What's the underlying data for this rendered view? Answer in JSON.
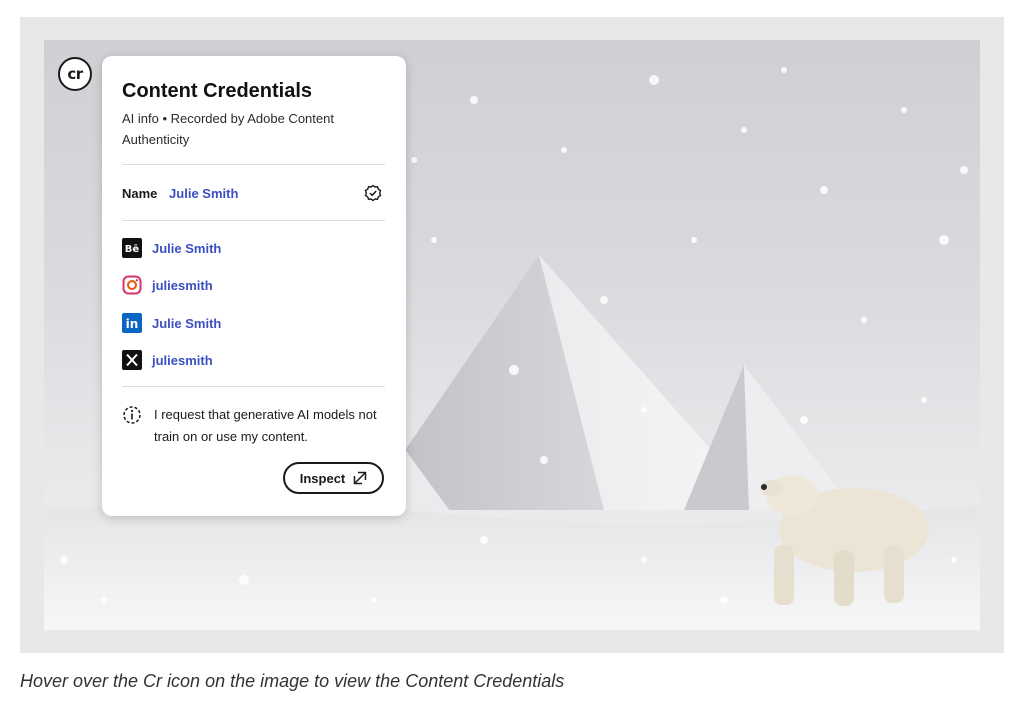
{
  "badge": {
    "label": "cr"
  },
  "card": {
    "title": "Content Credentials",
    "subtitle": "AI info • Recorded by Adobe Content Authenticity",
    "name_label": "Name",
    "name_value": "Julie Smith",
    "socials": [
      {
        "icon": "behance-icon",
        "label": "Julie Smith"
      },
      {
        "icon": "instagram-icon",
        "label": "juliesmith"
      },
      {
        "icon": "linkedin-icon",
        "label": "Julie Smith"
      },
      {
        "icon": "x-icon",
        "label": "juliesmith"
      }
    ],
    "notice": "I request that generative AI models not train on or use my content.",
    "inspect_label": "Inspect"
  },
  "colors": {
    "link": "#3b4fc2",
    "text": "#1a1a1a",
    "frame": "#e8e8e8"
  },
  "caption": "Hover over the Cr icon on the image to view the Content Credentials"
}
